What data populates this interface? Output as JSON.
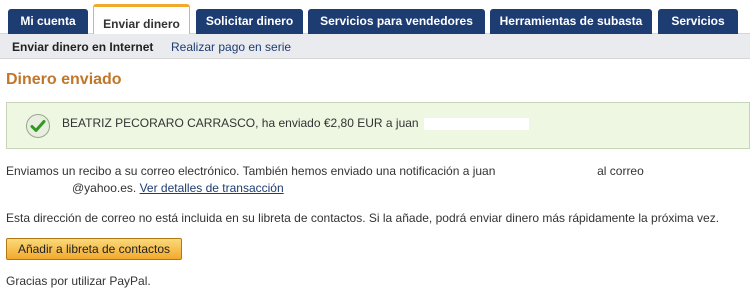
{
  "tabs": [
    {
      "label": "Mi cuenta"
    },
    {
      "label": "Enviar dinero"
    },
    {
      "label": "Solicitar dinero"
    },
    {
      "label": "Servicios para vendedores"
    },
    {
      "label": "Herramientas de subasta"
    },
    {
      "label": "Servicios"
    }
  ],
  "subnav": {
    "current": "Enviar dinero en Internet",
    "link": "Realizar pago en serie"
  },
  "page": {
    "title": "Dinero enviado"
  },
  "success": {
    "message": "BEATRIZ PECORARO CARRASCO, ha enviado €2,80 EUR a juan",
    "icon": "check-icon"
  },
  "receipt": {
    "line1_text": "Enviamos un recibo a su correo electrónico. También hemos enviado una notificación a juan",
    "line1_suffix": "al correo",
    "line2_email_end": "@yahoo.es.",
    "details_link": "Ver detalles de transacción"
  },
  "contacts": {
    "notice": "Esta dirección de correo no está incluida en su libreta de contactos. Si la añade, podrá enviar dinero más rápidamente la próxima vez.",
    "add_button": "Añadir a libreta de contactos"
  },
  "footer": {
    "thanks": "Gracias por utilizar PayPal."
  },
  "colors": {
    "tab_bg": "#1d3c72",
    "active_tab_accent": "#f3a92d",
    "title": "#c0772a",
    "success_bg": "#eef7e2",
    "button_bg": "#f2a92c"
  }
}
